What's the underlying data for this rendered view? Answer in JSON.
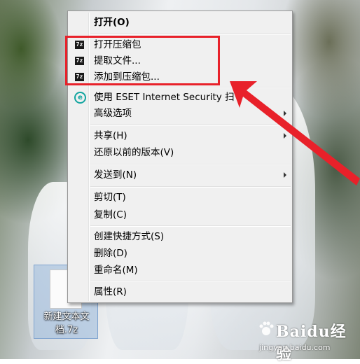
{
  "context_menu": {
    "items": [
      {
        "label": "打开(O)"
      },
      {
        "label": "打开压缩包",
        "icon": "7zip-icon"
      },
      {
        "label": "提取文件...",
        "icon": "7zip-icon"
      },
      {
        "label": "添加到压缩包...",
        "icon": "7zip-icon"
      },
      {
        "label": "使用 ESET Internet Security 扫",
        "icon": "eset-icon"
      },
      {
        "label": "高级选项"
      },
      {
        "label": "共享(H)"
      },
      {
        "label": "还原以前的版本(V)"
      },
      {
        "label": "发送到(N)"
      },
      {
        "label": "剪切(T)"
      },
      {
        "label": "复制(C)"
      },
      {
        "label": "创建快捷方式(S)"
      },
      {
        "label": "删除(D)"
      },
      {
        "label": "重命名(M)"
      },
      {
        "label": "属性(R)"
      }
    ]
  },
  "desktop_file": {
    "name": "新建文本文档.7z"
  },
  "watermark": {
    "brand": "Baidu经验",
    "url": "jingyan.baidu.com"
  },
  "colors": {
    "annotation": "#e8212a",
    "eset": "#12a5a0",
    "menu_bg": "#f0f0f0"
  }
}
